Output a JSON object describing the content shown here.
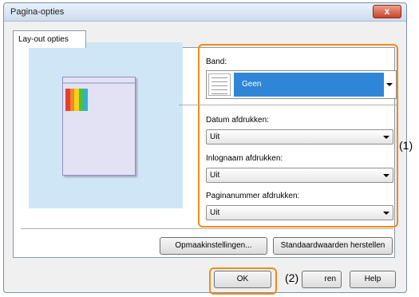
{
  "window": {
    "title": "Pagina-opties",
    "close_glyph": "x"
  },
  "tab": {
    "label": "Lay-out opties"
  },
  "band": {
    "label": "Band:",
    "selected": "Geen"
  },
  "date_print": {
    "label": "Datum afdrukken:",
    "selected": "Uit"
  },
  "login_print": {
    "label": "Inlognaam afdrukken:",
    "selected": "Uit"
  },
  "pagenum_print": {
    "label": "Paginanummer afdrukken:",
    "selected": "Uit"
  },
  "buttons": {
    "format_settings": "Opmaakinstellingen...",
    "restore_defaults": "Standaardwaarden herstellen",
    "ok": "OK",
    "cancel_visible": "ren",
    "help": "Help"
  },
  "callouts": {
    "one": "(1)",
    "two": "(2)"
  },
  "colors": {
    "highlight": "#f08a1c",
    "selection": "#2f86d8",
    "preview_bg": "#cfe6f6"
  }
}
